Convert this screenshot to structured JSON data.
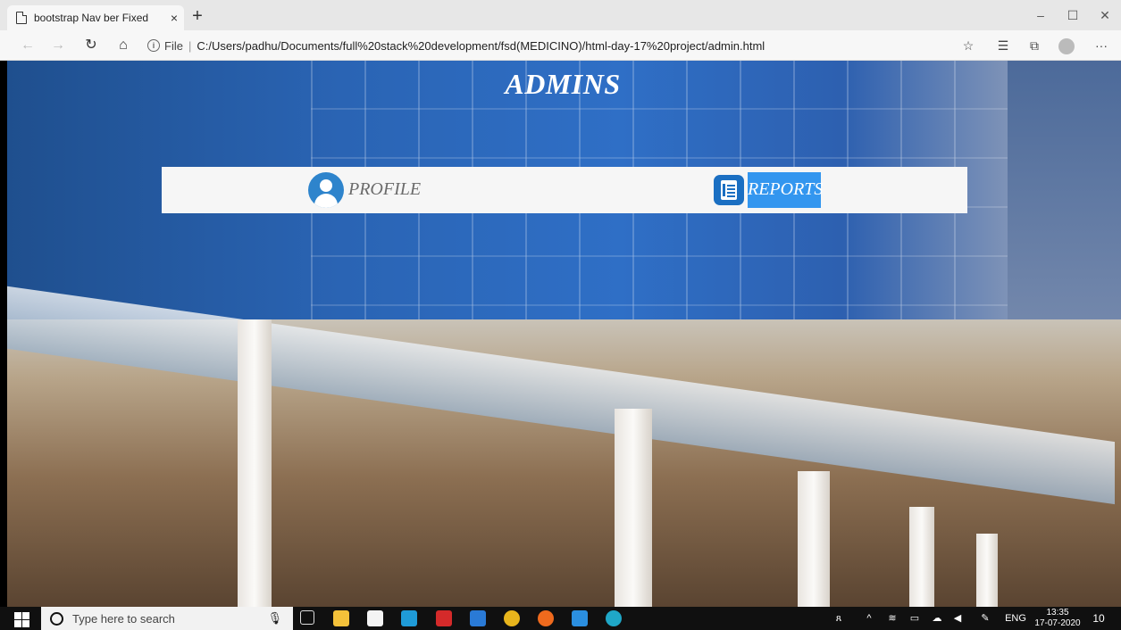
{
  "browser": {
    "tab_title": "bootstrap Nav ber Fixed",
    "tab_close": "×",
    "new_tab": "+",
    "file_label": "File",
    "separator": "|",
    "url": "C:/Users/padhu/Documents/full%20stack%20development/fsd(MEDICINO)/html-day-17%20project/admin.html",
    "window_controls": {
      "minimize": "–",
      "maximize": "☐",
      "close": "✕"
    },
    "nav_icons": {
      "back": "←",
      "forward": "→",
      "refresh": "↻",
      "home": "⌂"
    },
    "toolbar_icons": {
      "favorite": "☆",
      "favorites": "☰",
      "collections": "⧉",
      "more": "···"
    }
  },
  "page": {
    "title": "ADMINS",
    "menu": {
      "profile_label": "PROFILE",
      "reports_label": "REPORTS"
    }
  },
  "taskbar": {
    "search_placeholder": "Type here to search",
    "tray": {
      "language": "ENG",
      "time": "13:35",
      "date": "17-07-2020",
      "notifications": "10"
    }
  },
  "colors": {
    "reports_highlight": "#3396ef",
    "profile_icon": "#2e84cc",
    "panel": "#f6f6f6"
  }
}
